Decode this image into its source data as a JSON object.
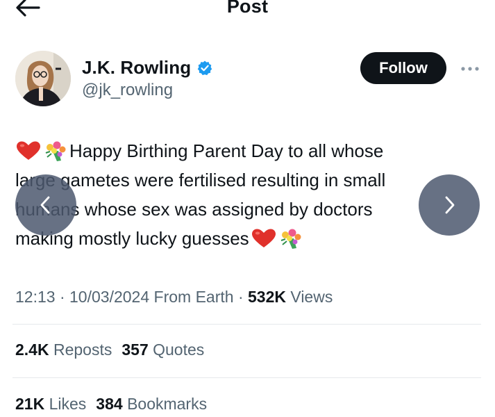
{
  "header": {
    "title": "Post"
  },
  "author": {
    "name": "J.K. Rowling",
    "handle": "@jk_rowling",
    "verified": true,
    "verified_color": "#1d9bf0"
  },
  "follow_label": "Follow",
  "tweet": {
    "lines": [
      "Happy Birthing Parent Day to all whose",
      "large gametes were fertilised resulting in small",
      "humans whose sex was assigned by doctors",
      "making mostly lucky guesses"
    ],
    "emojis": [
      "red-heart",
      "bouquet"
    ]
  },
  "meta": {
    "time": "12:13",
    "date": "10/03/2024",
    "source": "From Earth",
    "views_count": "532K",
    "views_label": "Views"
  },
  "stats": {
    "reposts_count": "2.4K",
    "reposts_label": "Reposts",
    "quotes_count": "357",
    "quotes_label": "Quotes",
    "likes_count": "21K",
    "likes_label": "Likes",
    "bookmarks_count": "384",
    "bookmarks_label": "Bookmarks"
  },
  "colors": {
    "text_primary": "#0f1419",
    "text_secondary": "#536471",
    "divider": "#e6e9ec",
    "follow_bg": "#0f1419",
    "carousel_overlay": "#4c586e"
  }
}
